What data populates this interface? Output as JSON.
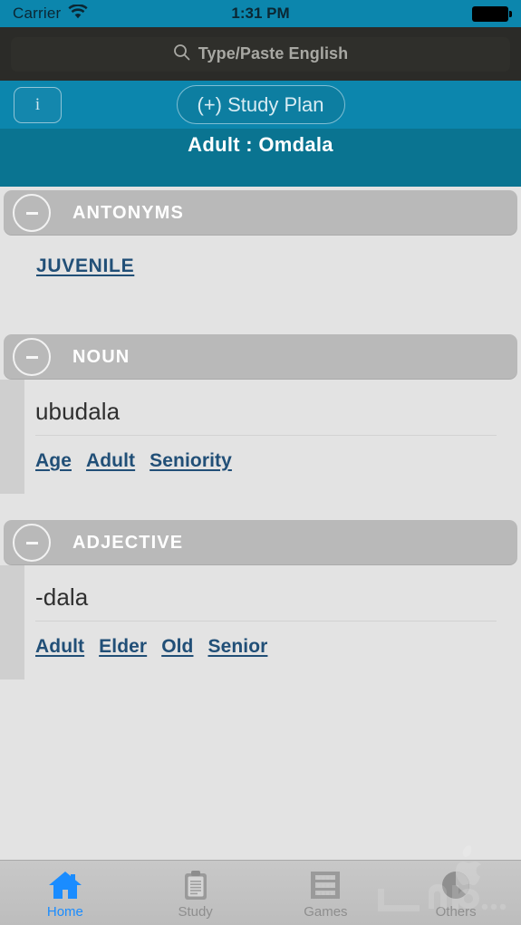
{
  "status_bar": {
    "carrier": "Carrier",
    "wifi_icon": "wifi-icon",
    "time": "1:31 PM",
    "battery_icon": "battery-icon"
  },
  "search": {
    "icon": "search-icon",
    "placeholder": "Type/Paste English",
    "value": ""
  },
  "toolbar": {
    "info_label": "i",
    "study_plan_label": "(+) Study Plan"
  },
  "header": {
    "title": "Adult : Omdala"
  },
  "colors": {
    "accent_teal": "#0c86ad",
    "title_band": "#0a7491",
    "section_header_gray": "#b9b9b9",
    "link_navy": "#214f77",
    "active_tab_blue": "#1a8cff",
    "search_dark": "#2b2b28",
    "content_bg": "#e3e3e3"
  },
  "sections": [
    {
      "id": "antonyms",
      "title": "ANTONYMS",
      "collapse_icon": "minus-icon",
      "headword": "",
      "links": [
        "JUVENILE"
      ]
    },
    {
      "id": "noun",
      "title": "NOUN",
      "collapse_icon": "minus-icon",
      "headword": "ubudala",
      "links": [
        "Age",
        "Adult",
        "Seniority"
      ]
    },
    {
      "id": "adjective",
      "title": "ADJECTIVE",
      "collapse_icon": "minus-icon",
      "headword": "-dala",
      "links": [
        "Adult",
        "Elder",
        "Old",
        "Senior"
      ]
    }
  ],
  "tabbar": {
    "items": [
      {
        "label": "Home",
        "icon": "home-icon",
        "active": true
      },
      {
        "label": "Study",
        "icon": "clipboard-icon",
        "active": false
      },
      {
        "label": "Games",
        "icon": "abacus-icon",
        "active": false
      },
      {
        "label": "Others",
        "icon": "pie-chart-icon",
        "active": false
      }
    ]
  }
}
